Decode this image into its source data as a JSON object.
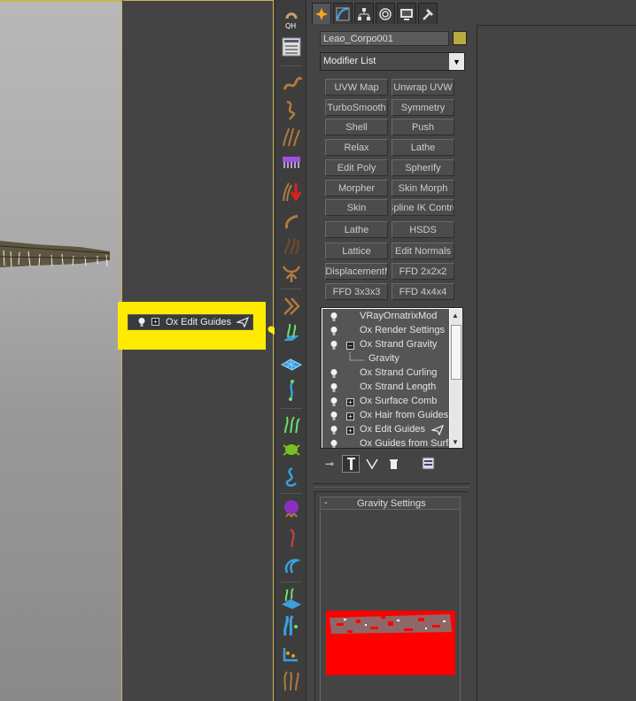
{
  "command_panel": {
    "object_name": "Leao_Corpo001",
    "object_color": "#b6ab3d",
    "modifier_list": "Modifier List",
    "modifier_buttons": [
      "UVW Map",
      "Unwrap UVW",
      "TurboSmooth",
      "Symmetry",
      "Shell",
      "Push",
      "Relax",
      "Lathe",
      "Edit Poly",
      "Spherify",
      "Morpher",
      "Skin Morph",
      "Skin",
      "Spline IK Control",
      "Lathe",
      "HSDS",
      "Lattice",
      "Edit Normals",
      "yDisplacementM",
      "FFD 2x2x2",
      "FFD 3x3x3",
      "FFD 4x4x4"
    ],
    "stack": [
      {
        "label": "VRayOrnatrixMod",
        "expander": ""
      },
      {
        "label": "Ox Render Settings",
        "expander": ""
      },
      {
        "label": "Ox Strand Gravity",
        "expander": "−"
      },
      {
        "label": "Gravity",
        "expander": ""
      },
      {
        "label": "Ox Strand Curling",
        "expander": ""
      },
      {
        "label": "Ox Strand Length",
        "expander": ""
      },
      {
        "label": "Ox Surface Comb",
        "expander": "+"
      },
      {
        "label": "Ox Hair from Guides",
        "expander": "+"
      },
      {
        "label": "Ox Edit Guides",
        "expander": "+"
      },
      {
        "label": "Ox Guides from Surfa",
        "expander": ""
      }
    ],
    "rollout": {
      "collapse": "-",
      "title": "Gravity Settings"
    }
  },
  "callout": {
    "label": "Ox Edit Guides",
    "expander": "+",
    "highlight_color": "#ffeb00"
  },
  "toolbar": {
    "qh_label": "QH"
  },
  "colors": {
    "highlight": "#ffeb00",
    "red_area": "#ff0000",
    "arrow": "#ffeb00"
  }
}
